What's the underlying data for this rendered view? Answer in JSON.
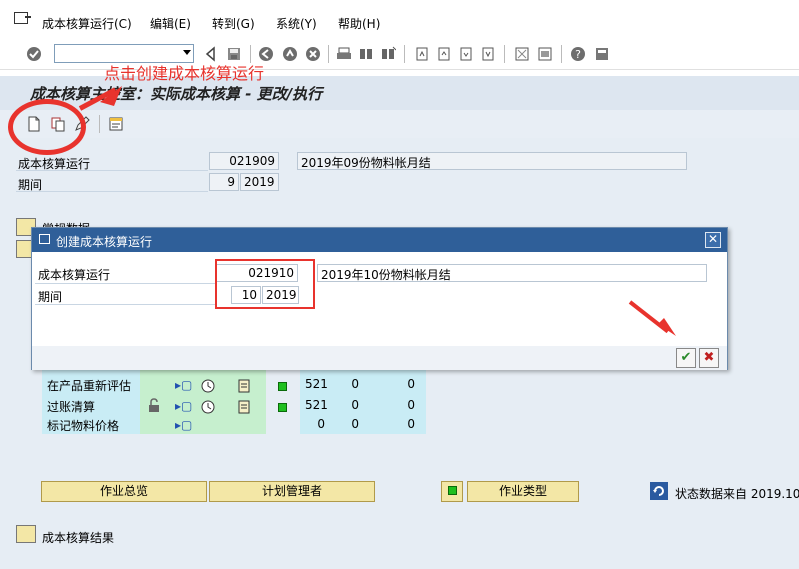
{
  "menu": {
    "items": [
      "成本核算运行(C)",
      "编辑(E)",
      "转到(G)",
      "系统(Y)",
      "帮助(H)"
    ]
  },
  "title": "成本核算主控室：实际成本核算 - 更改/执行",
  "annotation": "点击创建成本核算运行",
  "main": {
    "run_label": "成本核算运行",
    "run_id": "021909",
    "run_desc": "2019年09份物料帐月结",
    "period_label": "期间",
    "period_month": "9",
    "period_year": "2019",
    "section_hidden": "常规数据"
  },
  "dialog": {
    "title": "创建成本核算运行",
    "run_label": "成本核算运行",
    "run_id": "021910",
    "run_desc": "2019年10份物料帐月结",
    "period_label": "期间",
    "period_month": "10",
    "period_year": "2019",
    "ok_label": "✔",
    "cancel_label": "✖",
    "close_label": "✕"
  },
  "steps": {
    "rows": [
      {
        "name": "在产品重新评估",
        "n1": "521",
        "n2": "0",
        "n3": "0",
        "lock": false
      },
      {
        "name": "过账清算",
        "n1": "521",
        "n2": "0",
        "n3": "0",
        "lock": true
      },
      {
        "name": "标记物料价格",
        "n1": "0",
        "n2": "0",
        "n3": "0",
        "lock": false
      }
    ]
  },
  "buttons": {
    "overview": "作业总览",
    "planner": "计划管理者",
    "job_type": "作业类型",
    "status_text": "状态数据来自 2019.10"
  },
  "results": "成本核算结果",
  "colors": {
    "accent_red": "#e8332d",
    "dialog_title": "#2f5f99",
    "button_yellow": "#f3e7a6"
  }
}
